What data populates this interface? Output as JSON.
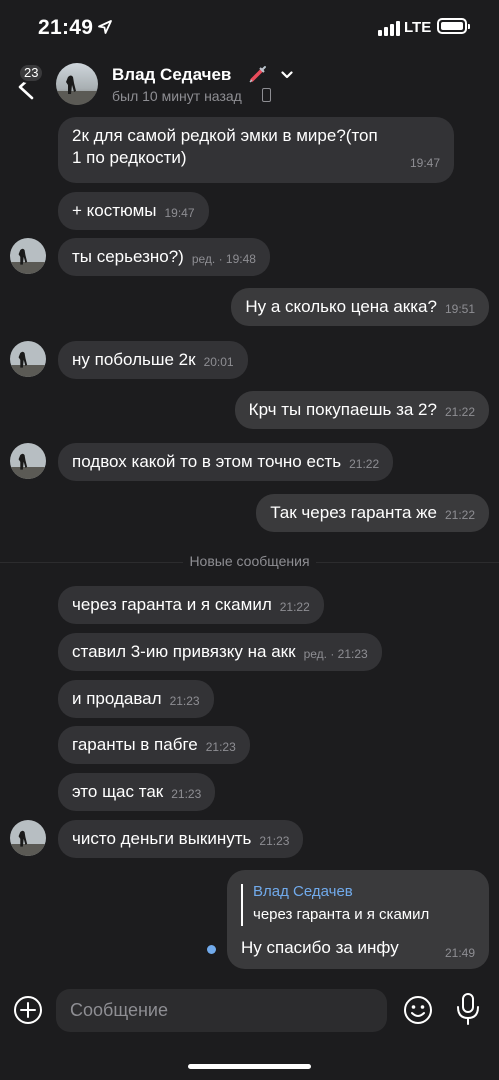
{
  "status_bar": {
    "time": "21:49",
    "network": "LTE"
  },
  "header": {
    "unread_count": "23",
    "contact_name": "Влад Седачев",
    "last_seen": "был 10 минут назад",
    "emoji_icon": "syringe-icon"
  },
  "messages": [
    {
      "dir": "in",
      "text_line1": "2к для самой редкой эмки в мире?(топ",
      "text_line2": "1 по редкости)",
      "time": "19:47"
    },
    {
      "dir": "in",
      "text": "+ костюмы",
      "time": "19:47"
    },
    {
      "dir": "in",
      "text": "ты серьезно?)",
      "time": "ред. · 19:48"
    },
    {
      "dir": "out",
      "text": "Ну а сколько цена акка?",
      "time": "19:51"
    },
    {
      "dir": "in",
      "text": "ну побольше 2к",
      "time": "20:01"
    },
    {
      "dir": "out",
      "text": "Крч ты покупаешь за 2?",
      "time": "21:22"
    },
    {
      "dir": "in",
      "text": "подвох какой то в этом точно есть",
      "time": "21:22"
    },
    {
      "dir": "out",
      "text": "Так через гаранта же",
      "time": "21:22"
    },
    {
      "dir": "in",
      "text": "через гаранта и я скамил",
      "time": "21:22"
    },
    {
      "dir": "in",
      "text": "ставил 3-ию привязку на акк",
      "time": "ред. · 21:23"
    },
    {
      "dir": "in",
      "text": "и продавал",
      "time": "21:23"
    },
    {
      "dir": "in",
      "text": "гаранты в пабге",
      "time": "21:23"
    },
    {
      "dir": "in",
      "text": "это щас так",
      "time": "21:23"
    },
    {
      "dir": "in",
      "text": "чисто деньги выкинуть",
      "time": "21:23"
    }
  ],
  "divider": {
    "label": "Новые сообщения"
  },
  "reply_message": {
    "quoted_name": "Влад Седачев",
    "quoted_text": "через гаранта и я скамил",
    "text": "Ну спасибо за инфу",
    "time": "21:49"
  },
  "input": {
    "placeholder": "Сообщение"
  },
  "colors": {
    "background": "#1c1c1e",
    "bubble": "#333336",
    "accent": "#71aaeb",
    "secondary_text": "#8e8e93"
  }
}
